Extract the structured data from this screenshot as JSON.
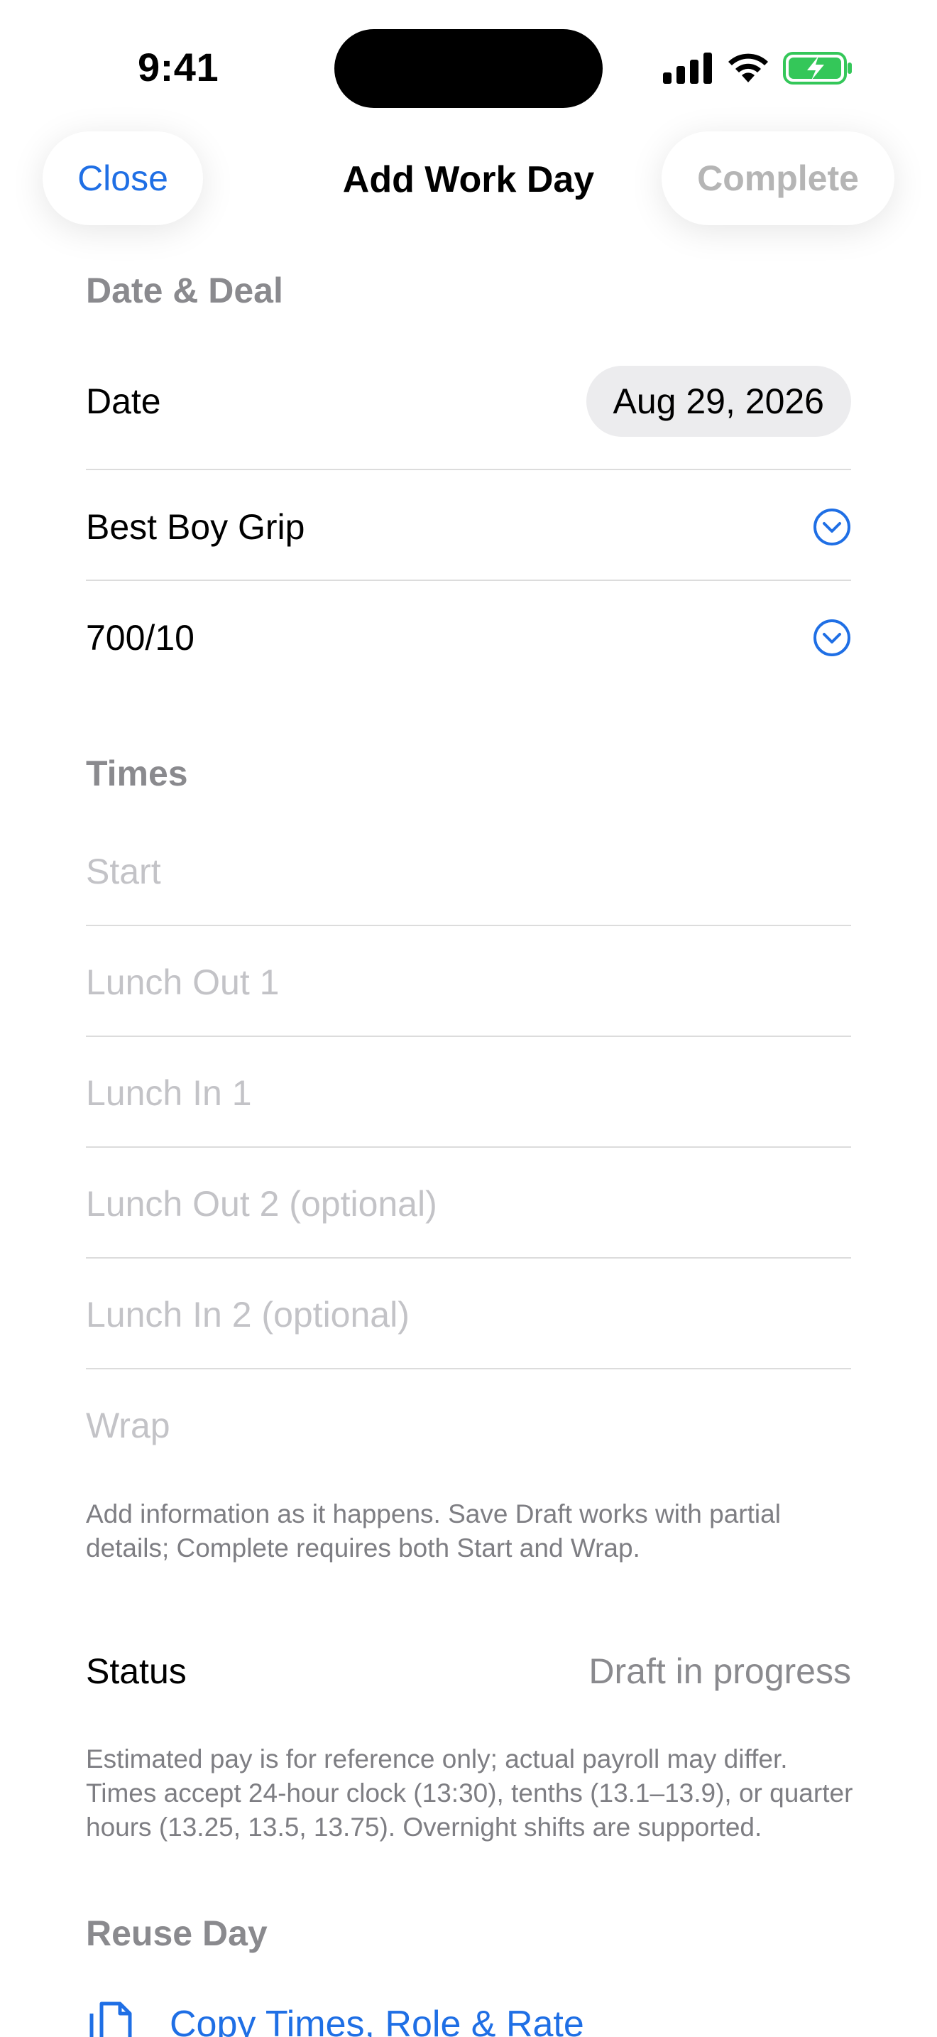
{
  "status_bar": {
    "time": "9:41"
  },
  "nav": {
    "close_label": "Close",
    "title": "Add Work Day",
    "complete_label": "Complete"
  },
  "date_deal": {
    "header": "Date & Deal",
    "date_label": "Date",
    "date_value": "Aug 29, 2026",
    "role_value": "Best Boy Grip",
    "rate_value": "700/10"
  },
  "times": {
    "header": "Times",
    "fields": [
      {
        "placeholder": "Start"
      },
      {
        "placeholder": "Lunch Out 1"
      },
      {
        "placeholder": "Lunch In 1"
      },
      {
        "placeholder": "Lunch Out 2 (optional)"
      },
      {
        "placeholder": "Lunch In 2 (optional)"
      },
      {
        "placeholder": "Wrap"
      }
    ],
    "footnote": "Add information as it happens. Save Draft works with partial details; Complete requires both Start and Wrap."
  },
  "status": {
    "label": "Status",
    "value": "Draft in progress",
    "footnote": "Estimated pay is for reference only; actual payroll may differ. Times accept 24-hour clock (13:30), tenths (13.1–13.9), or quarter hours (13.25, 13.5, 13.75). Overnight shifts are supported."
  },
  "reuse": {
    "header": "Reuse Day",
    "copy_label": "Copy Times, Role & Rate"
  },
  "colors": {
    "accent": "#1f6fe5",
    "battery": "#34c759"
  }
}
